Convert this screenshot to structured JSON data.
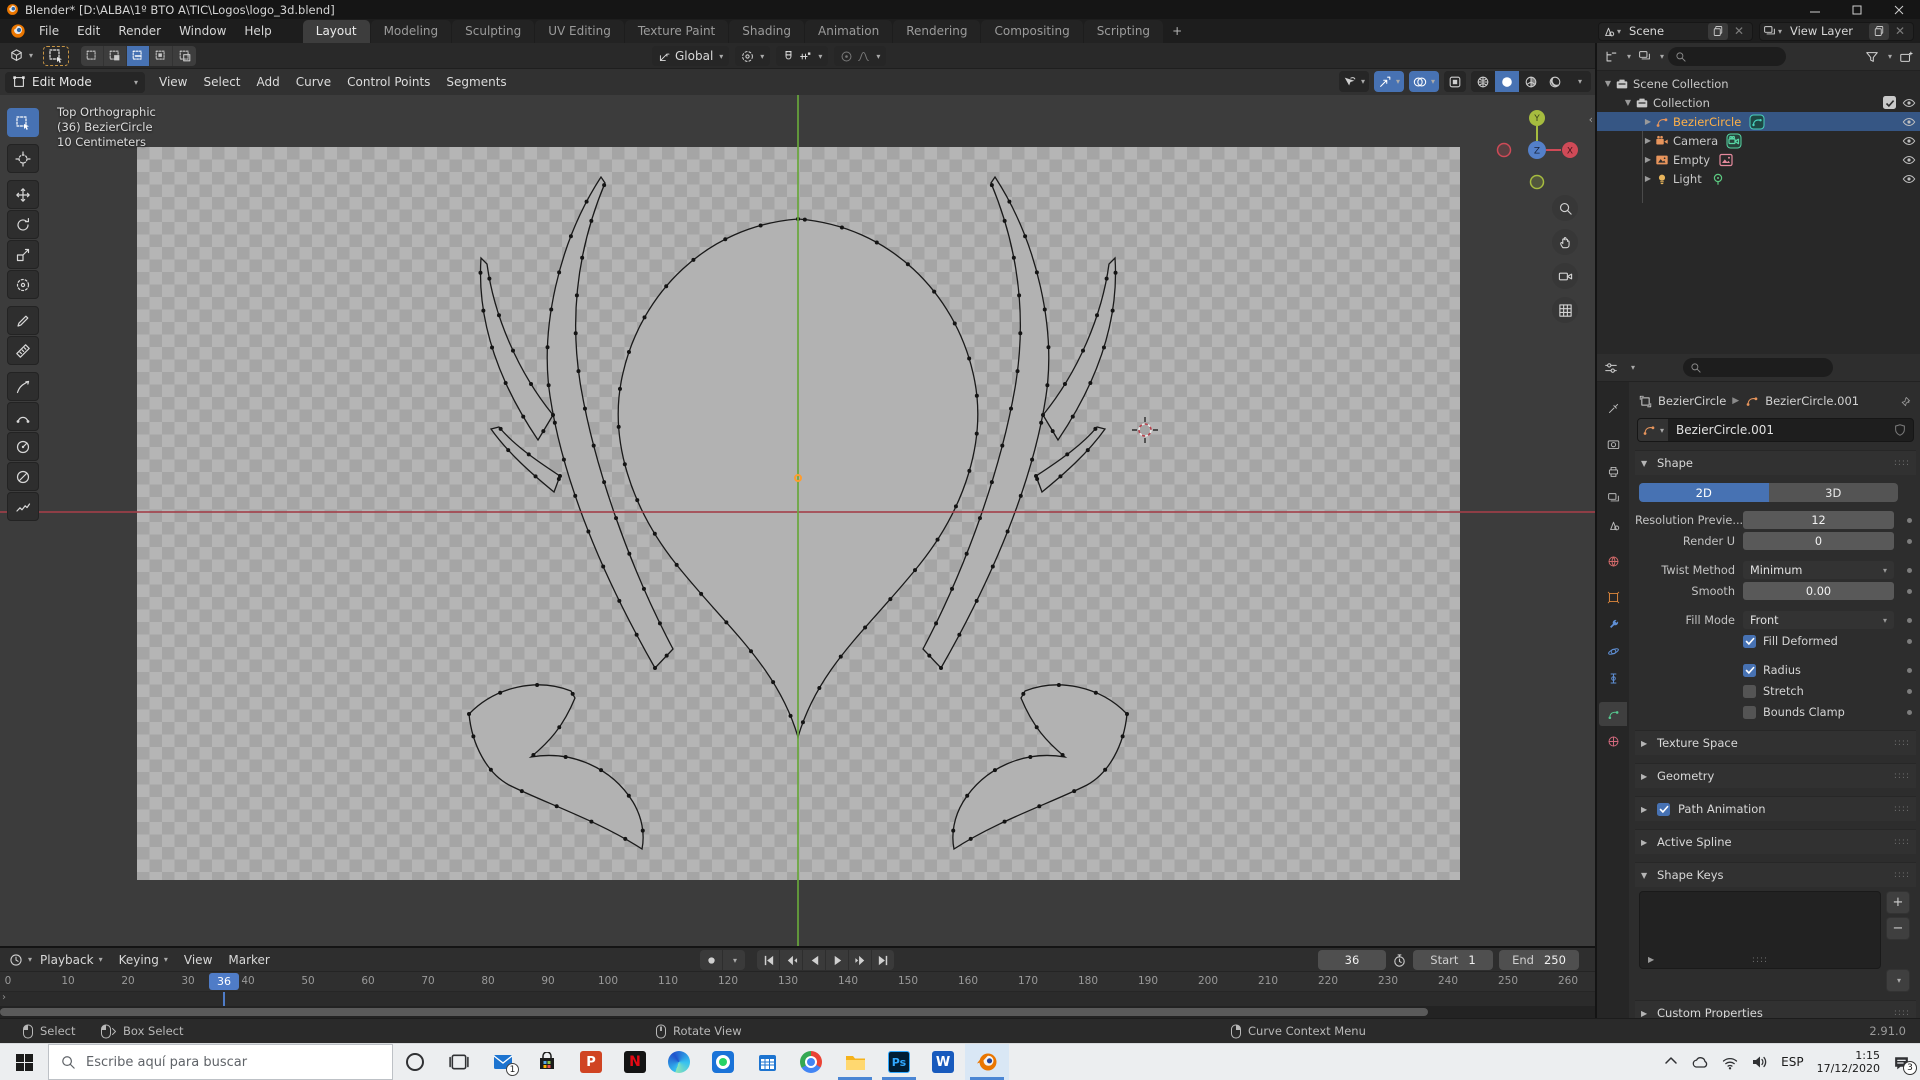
{
  "window": {
    "title": "Blender* [D:\\ALBA\\1º BTO A\\TIC\\Logos\\logo_3d.blend]"
  },
  "topbar": {
    "menus": [
      "File",
      "Edit",
      "Render",
      "Window",
      "Help"
    ],
    "tabs": [
      {
        "label": "Layout",
        "active": true
      },
      {
        "label": "Modeling"
      },
      {
        "label": "Sculpting"
      },
      {
        "label": "UV Editing"
      },
      {
        "label": "Texture Paint"
      },
      {
        "label": "Shading"
      },
      {
        "label": "Animation"
      },
      {
        "label": "Rendering"
      },
      {
        "label": "Compositing"
      },
      {
        "label": "Scripting"
      },
      {
        "label": "+",
        "plus": true
      }
    ],
    "scene": "Scene",
    "view_layer": "View Layer"
  },
  "tool_settings": {
    "orientation": "Global"
  },
  "viewport": {
    "mode": "Edit Mode",
    "menus": [
      "View",
      "Select",
      "Add",
      "Curve",
      "Control Points",
      "Segments"
    ],
    "info_lines": [
      "Top Orthographic",
      "(36) BezierCircle",
      "10 Centimeters"
    ],
    "axis_labels": {
      "x": "X",
      "y": "Y",
      "z": "Z"
    }
  },
  "toolbar": {
    "tools": [
      "select-box",
      "cursor",
      "move",
      "rotate",
      "scale",
      "transform",
      "annotate",
      "measure",
      "draw",
      "extrude",
      "radius",
      "tilt",
      "randomize"
    ],
    "active": "select-box",
    "group_starts": [
      "cursor",
      "move",
      "annotate",
      "draw"
    ]
  },
  "outliner": {
    "rows": [
      {
        "label": "Scene Collection",
        "level": 0,
        "icon": "collection",
        "expanded": true
      },
      {
        "label": "Collection",
        "level": 1,
        "icon": "collection",
        "expanded": true,
        "checkbox": true,
        "eye": true
      },
      {
        "label": "BezierCircle",
        "level": 2,
        "icon": "curve",
        "badge": "curve-data",
        "selected": true,
        "active": true,
        "eye": true
      },
      {
        "label": "Camera",
        "level": 2,
        "icon": "camera",
        "badge": "camera-data",
        "eye": true
      },
      {
        "label": "Empty",
        "level": 2,
        "icon": "image",
        "badge": "image-data",
        "eye": true
      },
      {
        "label": "Light",
        "level": 2,
        "icon": "light",
        "badge": "light-data",
        "eye": true
      }
    ]
  },
  "properties": {
    "tabs": [
      "tool",
      "render",
      "output",
      "view-layer",
      "scene",
      "world",
      "object",
      "modifiers",
      "physics",
      "constraints",
      "data",
      "material"
    ],
    "active_tab": "data",
    "breadcrumb": [
      "BezierCircle",
      "BezierCircle.001"
    ],
    "name_value": "BezierCircle.001",
    "shape_section": "Shape",
    "dim_buttons": [
      {
        "label": "2D",
        "active": true
      },
      {
        "label": "3D",
        "active": false
      }
    ],
    "rows": [
      {
        "label": "Resolution Previe...",
        "value": "12",
        "kind": "field"
      },
      {
        "label": "Render U",
        "value": "0",
        "kind": "field"
      },
      {
        "label": "Twist Method",
        "value": "Minimum",
        "kind": "dropdown",
        "gap": true
      },
      {
        "label": "Smooth",
        "value": "0.00",
        "kind": "field"
      },
      {
        "label": "Fill Mode",
        "value": "Front",
        "kind": "dropdown",
        "gap": true
      },
      {
        "label": "Fill Deformed",
        "kind": "checkbox",
        "checked": true
      },
      {
        "label": "Radius",
        "kind": "checkbox",
        "checked": true,
        "gap": true
      },
      {
        "label": "Stretch",
        "kind": "checkbox",
        "checked": false
      },
      {
        "label": "Bounds Clamp",
        "kind": "checkbox",
        "checked": false
      }
    ],
    "sections": [
      {
        "label": "Texture Space"
      },
      {
        "label": "Geometry"
      },
      {
        "label": "Path Animation",
        "checkbox": true,
        "checked": true
      },
      {
        "label": "Active Spline"
      },
      {
        "label": "Shape Keys",
        "expanded": true,
        "list": true
      },
      {
        "label": "Custom Properties"
      }
    ]
  },
  "timeline": {
    "menus": [
      {
        "label": "Playback",
        "chev": true
      },
      {
        "label": "Keying",
        "chev": true
      },
      {
        "label": "View"
      },
      {
        "label": "Marker"
      }
    ],
    "current_frame": "36",
    "start_label": "Start",
    "start_value": "1",
    "end_label": "End",
    "end_value": "250",
    "ticks": [
      0,
      10,
      20,
      30,
      40,
      50,
      60,
      70,
      80,
      90,
      100,
      110,
      120,
      130,
      140,
      150,
      160,
      170,
      180,
      190,
      200,
      210,
      220,
      230,
      240,
      250,
      260
    ],
    "playhead": 36
  },
  "statusbar": {
    "hints": [
      {
        "icon": "mouse-left",
        "label": "Select"
      },
      {
        "icon": "mouse-left-drag",
        "label": "Box Select"
      },
      {
        "icon": "mouse-middle",
        "label": "Rotate View"
      },
      {
        "icon": "mouse-right",
        "label": "Curve Context Menu"
      }
    ],
    "version": "2.91.0"
  },
  "taskbar": {
    "search_placeholder": "Escribe aquí para buscar",
    "language": "ESP",
    "time": "1:15",
    "date": "17/12/2020",
    "notification_count": "3",
    "icon_letters": {
      "powerpoint": "P",
      "netflix": "N",
      "word": "W",
      "photoshop": "Ps"
    },
    "apps": [
      {
        "name": "cortana"
      },
      {
        "name": "task-view"
      },
      {
        "name": "mail",
        "badge": "1"
      },
      {
        "name": "store"
      },
      {
        "name": "powerpoint"
      },
      {
        "name": "netflix"
      },
      {
        "name": "edge"
      },
      {
        "name": "whatsapp"
      },
      {
        "name": "calendar"
      },
      {
        "name": "chrome"
      },
      {
        "name": "explorer",
        "open": true
      },
      {
        "name": "photoshop",
        "open": true
      },
      {
        "name": "word"
      },
      {
        "name": "blender",
        "open": true,
        "active": true
      }
    ]
  },
  "colors": {
    "accent": "#4772b3",
    "selection": "#365684",
    "active_text": "#ffb148"
  }
}
